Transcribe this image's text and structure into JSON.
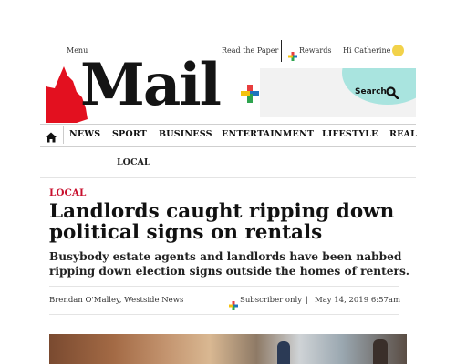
{
  "header": {
    "menu_label": "Menu",
    "read_paper_label": "Read the Paper",
    "rewards_label": "Rewards",
    "greeting": "Hi Catherine"
  },
  "masthead": {
    "logo_text": "Mail",
    "search_label": "Search"
  },
  "nav": {
    "items": [
      "NEWS",
      "SPORT",
      "BUSINESS",
      "ENTERTAINMENT",
      "LIFESTYLE",
      "REAL"
    ],
    "sub_item": "LOCAL"
  },
  "article": {
    "section": "LOCAL",
    "headline": "Landlords caught ripping down political signs on rentals",
    "standfirst": "Busybody estate agents and landlords have been nabbed ripping down election signs outside the homes of renters.",
    "byline": "Brendan O'Malley, Westside News",
    "access": "Subscriber only",
    "separator": "|",
    "timestamp": "May 14, 2019 6:57am"
  },
  "colors": {
    "accent_red": "#c8102e",
    "plus_yellow": "#f4c20d",
    "plus_blue": "#1e73be",
    "plus_red": "#e83e3e",
    "plus_green": "#2ea44f",
    "search_teal": "#a9e4df",
    "state_red": "#e3101f"
  },
  "icons": {
    "plus": "plus-brand-icon",
    "search": "search-icon",
    "home": "home-icon",
    "coin": "coin-icon"
  }
}
